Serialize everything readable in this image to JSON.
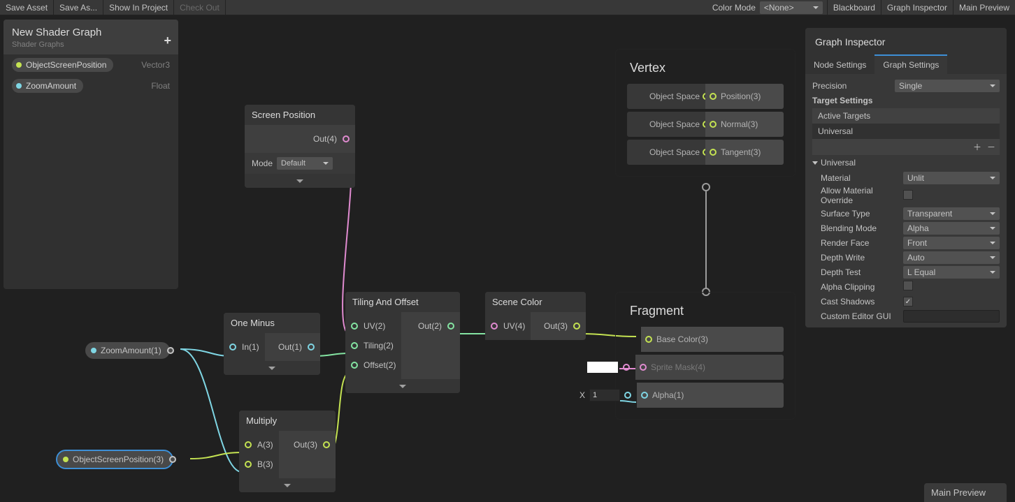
{
  "toolbar": {
    "save_asset": "Save Asset",
    "save_as": "Save As...",
    "show_in_project": "Show In Project",
    "check_out": "Check Out",
    "color_mode_label": "Color Mode",
    "color_mode_value": "<None>",
    "blackboard": "Blackboard",
    "graph_inspector": "Graph Inspector",
    "main_preview": "Main Preview"
  },
  "blackboard": {
    "title": "New Shader Graph",
    "subtitle": "Shader Graphs",
    "props": [
      {
        "name": "ObjectScreenPosition",
        "type": "Vector3",
        "dot": "dot-yellow"
      },
      {
        "name": "ZoomAmount",
        "type": "Float",
        "dot": "dot-cyan"
      }
    ]
  },
  "nodes": {
    "screen_position": {
      "title": "Screen Position",
      "out": "Out(4)",
      "mode_label": "Mode",
      "mode_value": "Default"
    },
    "one_minus": {
      "title": "One Minus",
      "in": "In(1)",
      "out": "Out(1)"
    },
    "multiply": {
      "title": "Multiply",
      "a": "A(3)",
      "b": "B(3)",
      "out": "Out(3)"
    },
    "tiling": {
      "title": "Tiling And Offset",
      "uv": "UV(2)",
      "tiling": "Tiling(2)",
      "offset": "Offset(2)",
      "out": "Out(2)"
    },
    "scene_color": {
      "title": "Scene Color",
      "uv": "UV(4)",
      "out": "Out(3)"
    }
  },
  "tokens": {
    "zoom": "ZoomAmount(1)",
    "osp": "ObjectScreenPosition(3)"
  },
  "vertex": {
    "title": "Vertex",
    "rows": [
      {
        "label": "Object Space",
        "field": "Position(3)"
      },
      {
        "label": "Object Space",
        "field": "Normal(3)"
      },
      {
        "label": "Object Space",
        "field": "Tangent(3)"
      }
    ]
  },
  "fragment": {
    "title": "Fragment",
    "base_color": "Base Color(3)",
    "sprite_mask": "Sprite Mask(4)",
    "alpha_label": "X",
    "alpha_value": "1",
    "alpha_field": "Alpha(1)"
  },
  "inspector": {
    "title": "Graph Inspector",
    "tabs": {
      "node": "Node Settings",
      "graph": "Graph Settings"
    },
    "precision_label": "Precision",
    "precision_value": "Single",
    "target_settings": "Target Settings",
    "active_targets": "Active Targets",
    "targets": [
      "Universal"
    ],
    "universal": {
      "title": "Universal",
      "material_label": "Material",
      "material_value": "Unlit",
      "allow_mat_override": "Allow Material Override",
      "surface_type_label": "Surface Type",
      "surface_type_value": "Transparent",
      "blending_mode_label": "Blending Mode",
      "blending_mode_value": "Alpha",
      "render_face_label": "Render Face",
      "render_face_value": "Front",
      "depth_write_label": "Depth Write",
      "depth_write_value": "Auto",
      "depth_test_label": "Depth Test",
      "depth_test_value": "L Equal",
      "alpha_clipping": "Alpha Clipping",
      "cast_shadows": "Cast Shadows",
      "custom_editor": "Custom Editor GUI"
    }
  },
  "main_preview": {
    "title": "Main Preview"
  }
}
